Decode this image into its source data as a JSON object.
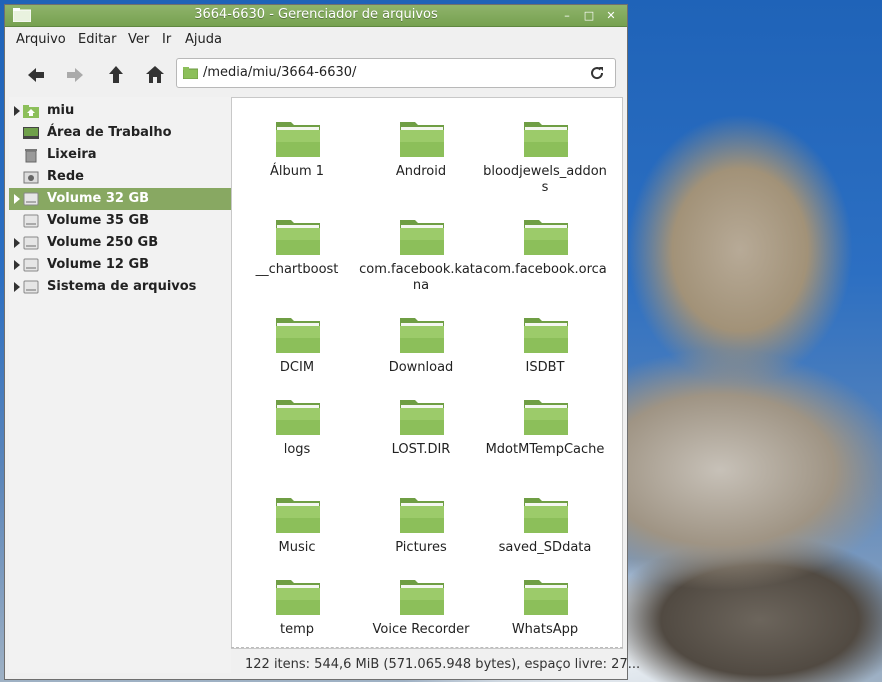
{
  "window": {
    "title": "3664-6630 - Gerenciador de arquivos",
    "controls": {
      "minimize": "–",
      "maximize": "□",
      "close": "✕"
    }
  },
  "menu": [
    "Arquivo",
    "Editar",
    "Ver",
    "Ir",
    "Ajuda"
  ],
  "toolbar": {
    "back_icon": "arrow-left-icon",
    "forward_icon": "arrow-right-icon",
    "up_icon": "arrow-up-icon",
    "home_icon": "home-icon",
    "location": "/media/miu/3664-6630/",
    "reload_icon": "reload-icon"
  },
  "sidebar": {
    "items": [
      {
        "label": "miu",
        "icon": "home-folder-icon",
        "expandable": true,
        "selected": false
      },
      {
        "label": "Área de Trabalho",
        "icon": "desktop-icon",
        "expandable": false,
        "selected": false
      },
      {
        "label": "Lixeira",
        "icon": "trash-icon",
        "expandable": false,
        "selected": false
      },
      {
        "label": "Rede",
        "icon": "network-icon",
        "expandable": false,
        "selected": false
      },
      {
        "label": "Volume 32 GB",
        "icon": "drive-icon",
        "expandable": true,
        "selected": true
      },
      {
        "label": "Volume 35 GB",
        "icon": "drive-icon",
        "expandable": false,
        "selected": false
      },
      {
        "label": "Volume 250 GB",
        "icon": "drive-icon",
        "expandable": true,
        "selected": false
      },
      {
        "label": "Volume 12 GB",
        "icon": "drive-icon",
        "expandable": true,
        "selected": false
      },
      {
        "label": "Sistema de arquivos",
        "icon": "drive-icon",
        "expandable": true,
        "selected": false
      }
    ]
  },
  "files": [
    {
      "name": "Álbum 1"
    },
    {
      "name": "Android"
    },
    {
      "name": "bloodjewels_addons"
    },
    {
      "name": "__chartboost"
    },
    {
      "name": "com.facebook.katana"
    },
    {
      "name": "com.facebook.orca"
    },
    {
      "name": "DCIM"
    },
    {
      "name": "Download"
    },
    {
      "name": "ISDBT"
    },
    {
      "name": "logs"
    },
    {
      "name": "LOST.DIR"
    },
    {
      "name": "MdotMTempCache"
    },
    {
      "name": "Music"
    },
    {
      "name": "Pictures"
    },
    {
      "name": "saved_SDdata"
    },
    {
      "name": "temp"
    },
    {
      "name": "Voice Recorder"
    },
    {
      "name": "WhatsApp"
    }
  ],
  "status": "122 itens: 544,6 MiB (571.065.948 bytes), espaço livre: 27...",
  "colors": {
    "accent": "#88a862",
    "folder": "#8cbf5a",
    "titlebar": "#7fa85a"
  }
}
